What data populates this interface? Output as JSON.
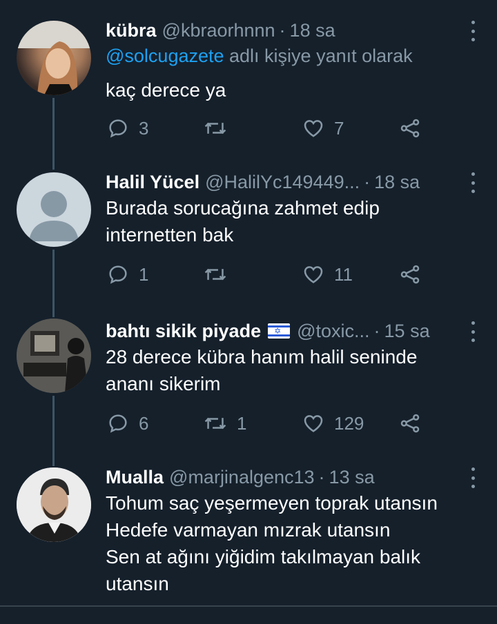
{
  "colors": {
    "background": "#15202b",
    "muted": "#8899a6",
    "link": "#1da1f2",
    "thread_line": "#3d5466"
  },
  "tweets": [
    {
      "name": "kübra",
      "handle": "@kbraorhnnn",
      "separator": "·",
      "time": "18 sa",
      "reply_to_mention": "@solcugazete",
      "reply_to_suffix": " adlı kişiye yanıt olarak",
      "lines": [
        "kaç derece ya"
      ],
      "replies": "3",
      "retweets": "",
      "likes": "7"
    },
    {
      "name": "Halil Yücel",
      "handle": "@HalilYc149449...",
      "separator": "·",
      "time": "18 sa",
      "lines": [
        "Burada sorucağına zahmet edip",
        "internetten bak"
      ],
      "replies": "1",
      "retweets": "",
      "likes": "11"
    },
    {
      "name": "bahtı sikik piyade",
      "handle": "@toxic...",
      "separator": "·",
      "time": "15 sa",
      "flag_icon": "israel-flag-icon",
      "lines": [
        "28 derece kübra hanım halil seninde",
        "ananı sikerim"
      ],
      "replies": "6",
      "retweets": "1",
      "likes": "129"
    },
    {
      "name": "Mualla",
      "handle": "@marjinalgenc13",
      "separator": "·",
      "time": "13 sa",
      "lines": [
        "Tohum saç yeşermeyen toprak utansın",
        "Hedefe varmayan mızrak utansın",
        "Sen at ağını yiğidim takılmayan balık",
        "utansın"
      ]
    }
  ]
}
